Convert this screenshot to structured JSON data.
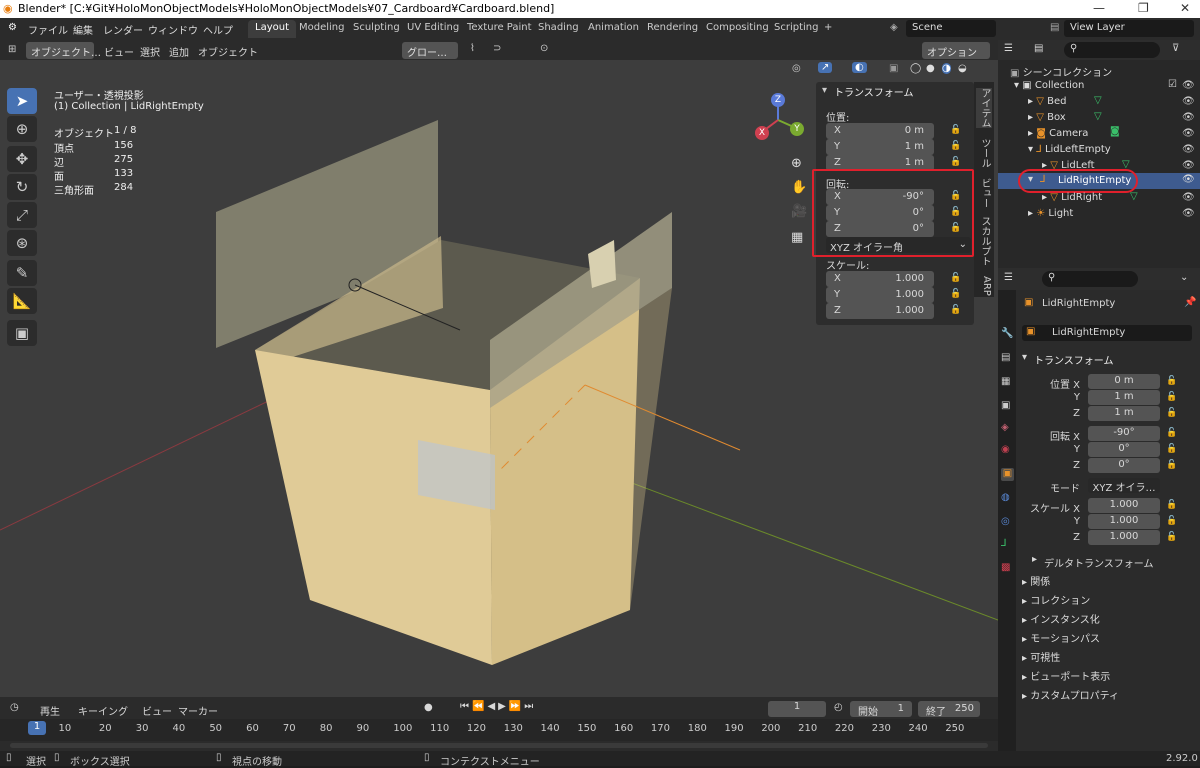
{
  "titlebar": {
    "title": "Blender* [C:¥Git¥HoloMonObjectModels¥HoloMonObjectModels¥07_Cardboard¥Cardboard.blend]"
  },
  "menus": [
    "ファイル",
    "編集",
    "レンダー",
    "ウィンドウ",
    "ヘルプ"
  ],
  "workspaces": [
    "Layout",
    "Modeling",
    "Sculpting",
    "UV Editing",
    "Texture Paint",
    "Shading",
    "Animation",
    "Rendering",
    "Compositing",
    "Scripting",
    "+"
  ],
  "scene": {
    "name": "Scene",
    "view_layer": "View Layer"
  },
  "viewport": {
    "header": {
      "mode": "オブジェクト…",
      "menus": [
        "ビュー",
        "選択",
        "追加",
        "オブジェクト"
      ],
      "transform": "グロー…",
      "options": "オプション"
    },
    "info": {
      "view": "ユーザー・透視投影",
      "collection": "(1) Collection | LidRightEmpty"
    },
    "stats": [
      {
        "k": "オブジェクト",
        "v": "1 / 8"
      },
      {
        "k": "頂点",
        "v": "156"
      },
      {
        "k": "辺",
        "v": "275"
      },
      {
        "k": "面",
        "v": "133"
      },
      {
        "k": "三角形面",
        "v": "284"
      }
    ],
    "gizmo": {
      "x": "X",
      "y": "Y",
      "z": "Z"
    }
  },
  "npanel": {
    "header": "トランスフォーム",
    "location_label": "位置:",
    "location": [
      {
        "a": "X",
        "v": "0 m"
      },
      {
        "a": "Y",
        "v": "1 m"
      },
      {
        "a": "Z",
        "v": "1 m"
      }
    ],
    "rotation_label": "回転:",
    "rotation": [
      {
        "a": "X",
        "v": "-90°"
      },
      {
        "a": "Y",
        "v": "0°"
      },
      {
        "a": "Z",
        "v": "0°"
      }
    ],
    "rotation_mode": "XYZ オイラー角",
    "scale_label": "スケール:",
    "scale": [
      {
        "a": "X",
        "v": "1.000"
      },
      {
        "a": "Y",
        "v": "1.000"
      },
      {
        "a": "Z",
        "v": "1.000"
      }
    ],
    "tabs": [
      "アイテム",
      "ツール",
      "ビュー",
      "スカルプト",
      "ARP"
    ],
    "highlight_color": "#e0202c"
  },
  "outliner": {
    "root": "シーンコレクション",
    "items": [
      {
        "name": "Collection",
        "indent": 0
      },
      {
        "name": "Bed",
        "indent": 1
      },
      {
        "name": "Box",
        "indent": 1
      },
      {
        "name": "Camera",
        "indent": 1
      },
      {
        "name": "LidLeftEmpty",
        "indent": 1
      },
      {
        "name": "LidLeft",
        "indent": 2
      },
      {
        "name": "LidRightEmpty",
        "indent": 1,
        "selected": true
      },
      {
        "name": "LidRight",
        "indent": 2
      },
      {
        "name": "Light",
        "indent": 1
      }
    ]
  },
  "properties": {
    "object_name": "LidRightEmpty",
    "object_field": "LidRightEmpty",
    "section": "トランスフォーム",
    "location": [
      {
        "l": "位置 X",
        "v": "0 m"
      },
      {
        "l": "Y",
        "v": "1 m"
      },
      {
        "l": "Z",
        "v": "1 m"
      }
    ],
    "rotation": [
      {
        "l": "回転 X",
        "v": "-90°"
      },
      {
        "l": "Y",
        "v": "0°"
      },
      {
        "l": "Z",
        "v": "0°"
      }
    ],
    "mode_label": "モード",
    "mode_value": "XYZ オイラ…",
    "scale": [
      {
        "l": "スケール X",
        "v": "1.000"
      },
      {
        "l": "Y",
        "v": "1.000"
      },
      {
        "l": "Z",
        "v": "1.000"
      }
    ],
    "delta": "デルタトランスフォーム",
    "sections": [
      "関係",
      "コレクション",
      "インスタンス化",
      "モーションパス",
      "可視性",
      "ビューポート表示",
      "カスタムプロパティ"
    ]
  },
  "timeline": {
    "menus": [
      "再生",
      "キーイング",
      "ビュー",
      "マーカー"
    ],
    "current": "1",
    "start_label": "開始",
    "start": "1",
    "end_label": "終了",
    "end": "250",
    "frames": [
      "1",
      "10",
      "20",
      "30",
      "40",
      "50",
      "60",
      "70",
      "80",
      "90",
      "100",
      "110",
      "120",
      "130",
      "140",
      "150",
      "160",
      "170",
      "180",
      "190",
      "200",
      "210",
      "220",
      "230",
      "240",
      "250"
    ]
  },
  "status": {
    "select": "選択",
    "box": "ボックス選択",
    "view": "視点の移動",
    "context": "コンテクストメニュー",
    "version": "2.92.0"
  }
}
